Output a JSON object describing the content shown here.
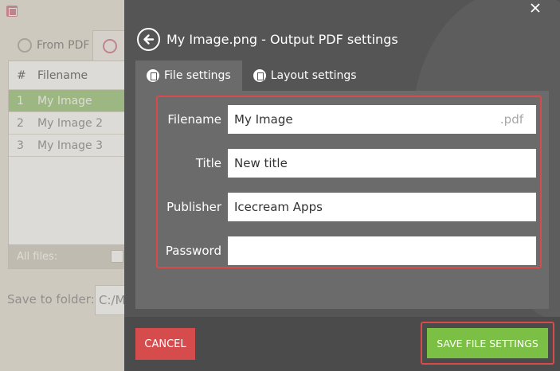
{
  "background_app": {
    "tabs": [
      {
        "label": "From PDF"
      }
    ],
    "table": {
      "headers": [
        "#",
        "Filename"
      ],
      "rows": [
        {
          "num": "1",
          "name": "My Image",
          "selected": true
        },
        {
          "num": "2",
          "name": "My Image 2",
          "selected": false
        },
        {
          "num": "3",
          "name": "My Image 3",
          "selected": false
        }
      ],
      "footer_label": "All files:"
    },
    "save_folder": {
      "label": "Save to folder:",
      "value": "C:/M"
    }
  },
  "dialog": {
    "title": "My Image.png - Output PDF settings",
    "close_icon": "close-icon",
    "back_icon": "back-arrow-icon",
    "tabs": [
      {
        "label": "File settings",
        "icon": "document-icon",
        "active": true
      },
      {
        "label": "Layout settings",
        "icon": "layout-icon",
        "active": false
      }
    ],
    "form": {
      "filename": {
        "label": "Filename",
        "value": "My Image",
        "extension": ".pdf"
      },
      "title": {
        "label": "Title",
        "value": "New title"
      },
      "publisher": {
        "label": "Publisher",
        "value": "Icecream Apps"
      },
      "password": {
        "label": "Password",
        "value": ""
      }
    },
    "buttons": {
      "cancel": "CANCEL",
      "save": "SAVE FILE SETTINGS"
    }
  },
  "colors": {
    "dialog_bg": "#555555",
    "panel_bg": "#6b6b6b",
    "cancel": "#d64b4b",
    "save": "#7cbf45",
    "highlight_frame": "#d94a4a",
    "selected_row": "#a9cf8c"
  }
}
